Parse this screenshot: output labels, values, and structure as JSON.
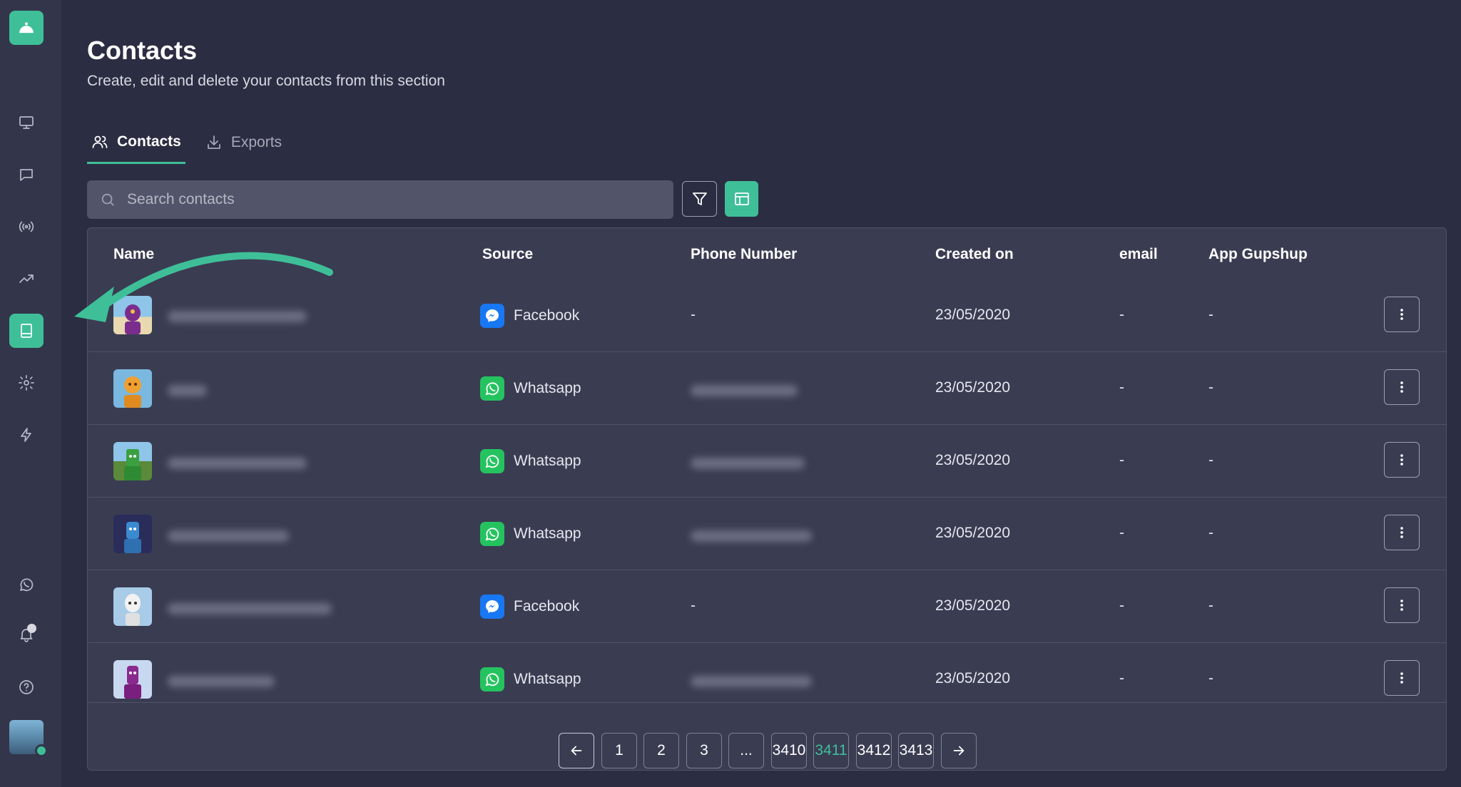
{
  "page": {
    "title": "Contacts",
    "subtitle": "Create, edit and delete your contacts from this section"
  },
  "tabs": [
    {
      "label": "Contacts",
      "icon": "users-icon",
      "active": true
    },
    {
      "label": "Exports",
      "icon": "download-icon",
      "active": false
    }
  ],
  "search": {
    "placeholder": "Search contacts",
    "value": ""
  },
  "colors": {
    "accent": "#3fbf98",
    "facebook": "#1877f2",
    "whatsapp": "#25c35f"
  },
  "table": {
    "columns": [
      "Name",
      "Source",
      "Phone Number",
      "Created on",
      "email",
      "App Gupshup"
    ],
    "rows": [
      {
        "source": "Facebook",
        "source_icon": "messenger-icon",
        "phone": "-",
        "created": "23/05/2020",
        "email": "-",
        "app_gupshup": "-"
      },
      {
        "source": "Whatsapp",
        "source_icon": "whatsapp-icon",
        "phone": "",
        "created": "23/05/2020",
        "email": "-",
        "app_gupshup": "-"
      },
      {
        "source": "Whatsapp",
        "source_icon": "whatsapp-icon",
        "phone": "",
        "created": "23/05/2020",
        "email": "-",
        "app_gupshup": "-"
      },
      {
        "source": "Whatsapp",
        "source_icon": "whatsapp-icon",
        "phone": "",
        "created": "23/05/2020",
        "email": "-",
        "app_gupshup": "-"
      },
      {
        "source": "Facebook",
        "source_icon": "messenger-icon",
        "phone": "-",
        "created": "23/05/2020",
        "email": "-",
        "app_gupshup": "-"
      },
      {
        "source": "Whatsapp",
        "source_icon": "whatsapp-icon",
        "phone": "",
        "created": "23/05/2020",
        "email": "-",
        "app_gupshup": "-"
      }
    ]
  },
  "pagination": {
    "pages": [
      "1",
      "2",
      "3",
      "...",
      "3410",
      "3411",
      "3412",
      "3413"
    ],
    "current": "3411"
  },
  "sidebar": {
    "items": [
      "desktop-icon",
      "chat-icon",
      "broadcast-icon",
      "analytics-icon",
      "book-icon",
      "settings-icon",
      "flash-icon",
      "whatsapp-icon",
      "bell-icon",
      "help-icon"
    ],
    "active": "book-icon"
  }
}
